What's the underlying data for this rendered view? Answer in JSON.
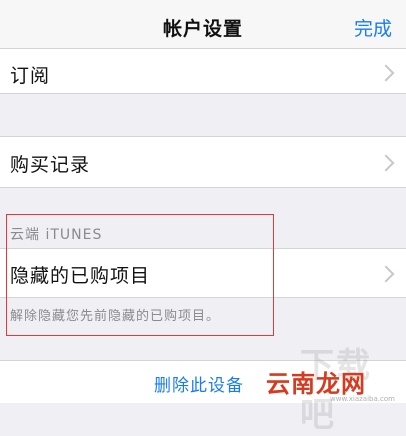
{
  "nav": {
    "title": "帐户设置",
    "done": "完成"
  },
  "rows": {
    "subscriptions": "订阅",
    "purchase_history": "购买记录",
    "hidden_purchases": "隐藏的已购项目"
  },
  "itunes_section": {
    "header": "云端 iTUNES",
    "footer": "解除隐藏您先前隐藏的已购项目。"
  },
  "actions": {
    "remove_device": "删除此设备"
  },
  "watermark": {
    "brand": "云南龙网",
    "ghost": "下载吧",
    "url": "www.xiazaiba.com"
  },
  "colors": {
    "accent": "#1a7cf3",
    "highlight": "#e23a3a"
  }
}
